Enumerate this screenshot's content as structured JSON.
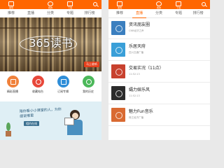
{
  "left": {
    "topbar": {
      "icons": [
        {
          "label": "发现",
          "icon": "discover-icon"
        },
        {
          "label": "我的",
          "icon": "mine-icon"
        },
        {
          "label": "下载",
          "icon": "download-icon"
        }
      ]
    },
    "tabs": [
      {
        "label": "推荐",
        "active": false
      },
      {
        "label": "直播",
        "active": false
      },
      {
        "label": "分类",
        "active": false
      },
      {
        "label": "专题",
        "active": false
      },
      {
        "label": "排行榜",
        "active": false
      }
    ],
    "banner": {
      "title": "365读书",
      "button": "马上收听"
    },
    "quick": [
      {
        "label": "精彩直播",
        "color": "#f0813b"
      },
      {
        "label": "收藏电台",
        "color": "#e8483a"
      },
      {
        "label": "订阅专辑",
        "color": "#2f8ed8"
      },
      {
        "label": "我的历史",
        "color": "#4cb85a"
      }
    ],
    "promo": {
      "text": "陪你看小小课堂的人，为你细说哪里",
      "badge": "相约在线"
    }
  },
  "right": {
    "topbar": {
      "icons": [
        {
          "label": "发现",
          "icon": "discover-icon"
        },
        {
          "label": "我的",
          "icon": "mine-icon"
        },
        {
          "label": "下载",
          "icon": "download-icon"
        }
      ]
    },
    "tabs": [
      {
        "label": "推荐",
        "active": false
      },
      {
        "label": "直播",
        "active": true
      },
      {
        "label": "分类",
        "active": false
      },
      {
        "label": "专题",
        "active": false
      },
      {
        "label": "排行榜",
        "active": false
      }
    ],
    "list": [
      {
        "title": "资讯朋友圈",
        "sub": "CNR经济之声",
        "color": "#3b7fbf"
      },
      {
        "title": "乐居天府",
        "sub": "四川交通广播",
        "color": "#3a9fd8"
      },
      {
        "title": "交易实况（11点）",
        "sub": "11:52:13",
        "color": "#c8412e"
      },
      {
        "title": "孀力娱乐风",
        "sub": "11:52:13",
        "color": "#2b2b2b"
      },
      {
        "title": "魅力Fun音乐",
        "sub": "珠江经济广播",
        "color": "#d96a32"
      }
    ]
  }
}
